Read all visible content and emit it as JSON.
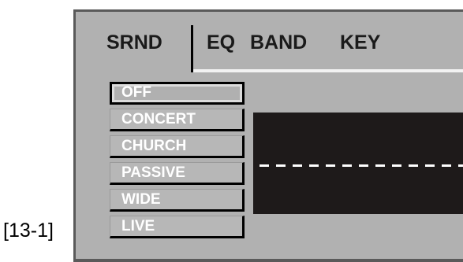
{
  "figure_label": "[13-1]",
  "tabs": [
    {
      "label": "SRND",
      "active": true
    },
    {
      "label": "EQ",
      "active": false
    },
    {
      "label": "BAND",
      "active": false
    },
    {
      "label": "KEY",
      "active": false
    }
  ],
  "surround_modes": [
    {
      "label": "OFF",
      "selected": true
    },
    {
      "label": "CONCERT",
      "selected": false
    },
    {
      "label": "CHURCH",
      "selected": false
    },
    {
      "label": "PASSIVE",
      "selected": false
    },
    {
      "label": "WIDE",
      "selected": false
    },
    {
      "label": "LIVE",
      "selected": false
    }
  ],
  "colors": {
    "panel": "#b1b1b1",
    "display_background": "#1e1a1a",
    "mode_text": "#ffffff",
    "tab_text": "#1a1a1a"
  }
}
